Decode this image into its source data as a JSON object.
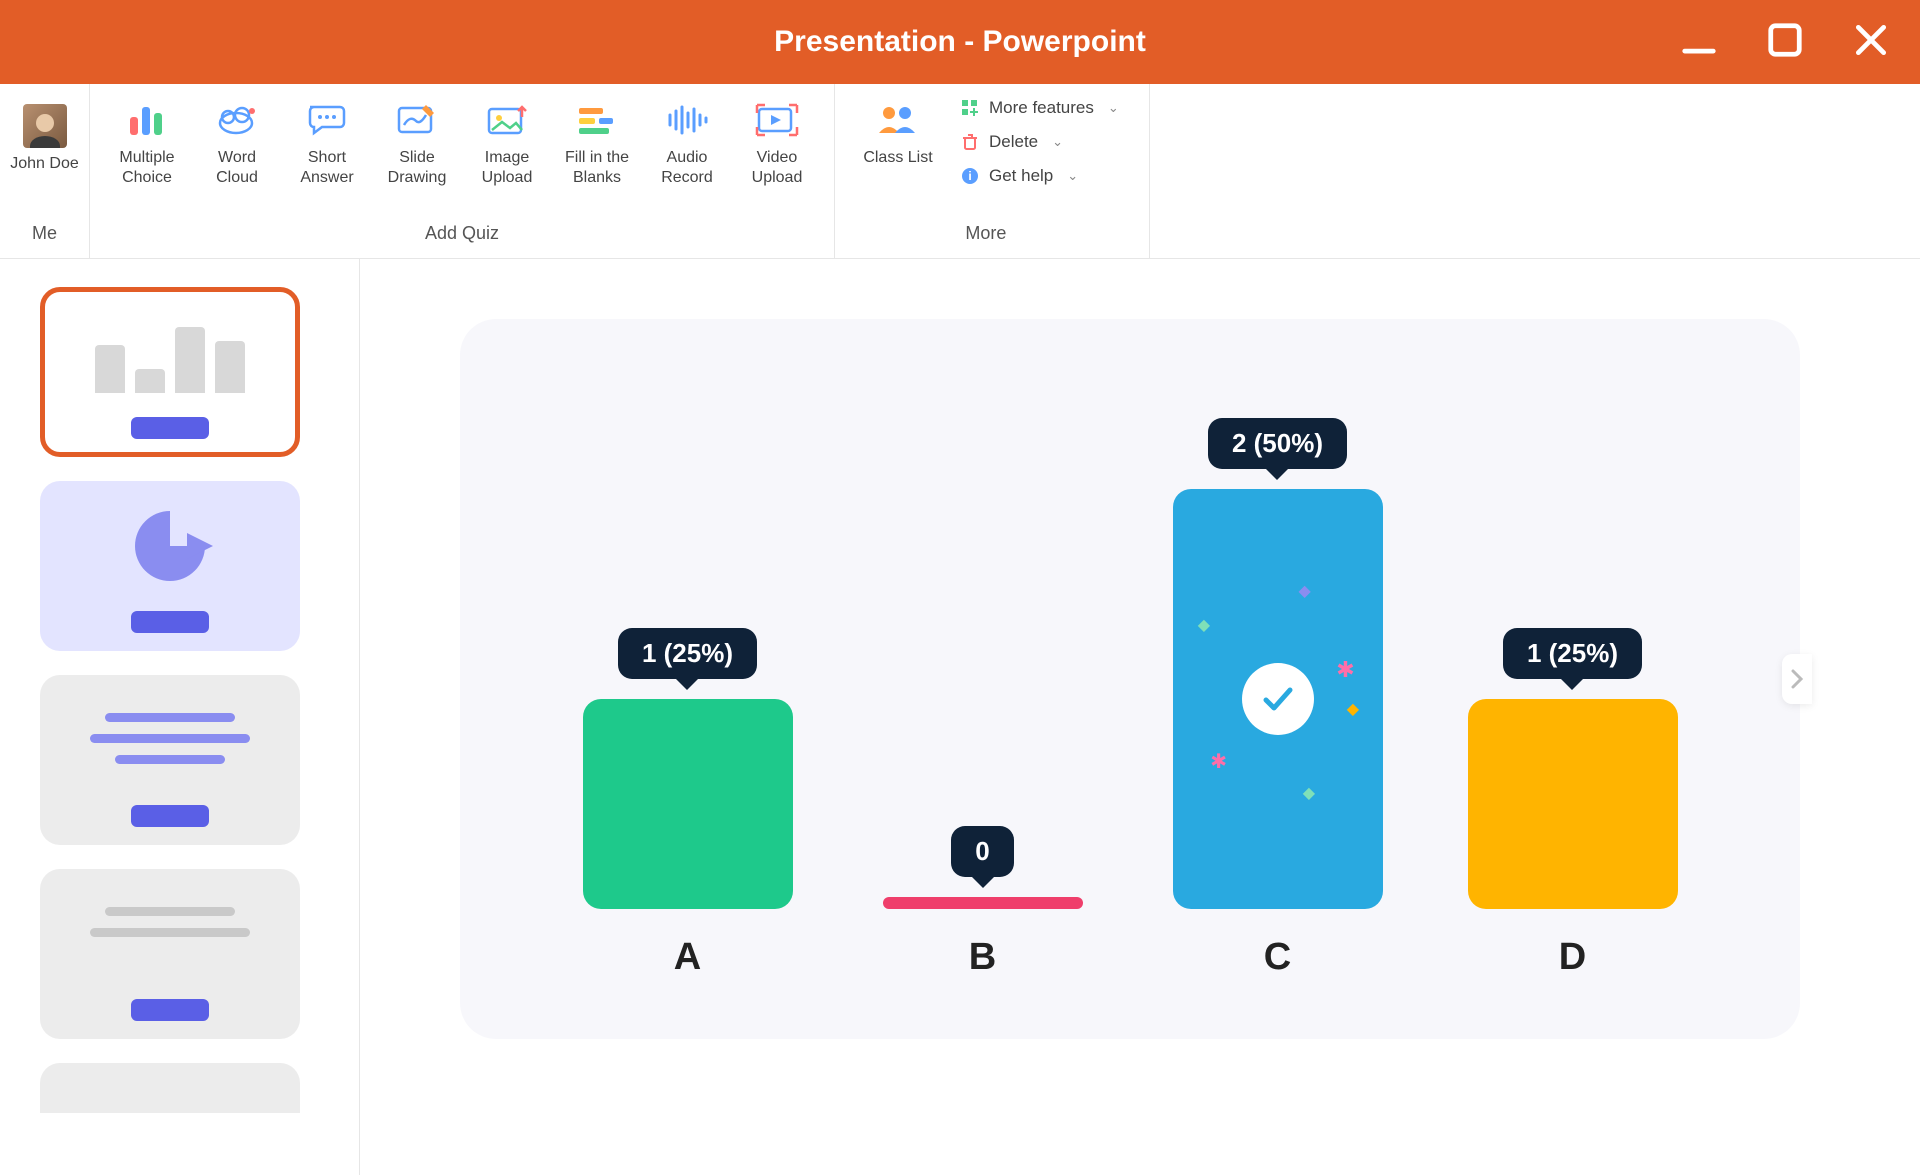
{
  "titlebar": {
    "title": "Presentation - Powerpoint"
  },
  "user": {
    "name": "John Doe",
    "group_label": "Me"
  },
  "ribbon": {
    "quiz_label": "Add Quiz",
    "tools": {
      "multiple_choice": "Multiple Choice",
      "word_cloud": "Word Cloud",
      "short_answer": "Short Answer",
      "slide_drawing": "Slide Drawing",
      "image_upload": "Image Upload",
      "fill_blanks": "Fill in the Blanks",
      "audio_record": "Audio Record",
      "video_upload": "Video Upload"
    },
    "more_label": "More",
    "class_list": "Class List",
    "more_items": {
      "more_features": "More features",
      "delete": "Delete",
      "get_help": "Get help"
    }
  },
  "chart_data": {
    "type": "bar",
    "categories": [
      "A",
      "B",
      "C",
      "D"
    ],
    "values": [
      1,
      0,
      2,
      1
    ],
    "labels": [
      "1 (25%)",
      "0",
      "2 (50%)",
      "1 (25%)"
    ],
    "colors": [
      "#1ec98b",
      "#ef3e6b",
      "#29a9e0",
      "#ffb400"
    ],
    "correct_index": 2,
    "total_responses": 4,
    "title": "",
    "xlabel": "",
    "ylabel": "",
    "ylim": [
      0,
      2
    ]
  }
}
